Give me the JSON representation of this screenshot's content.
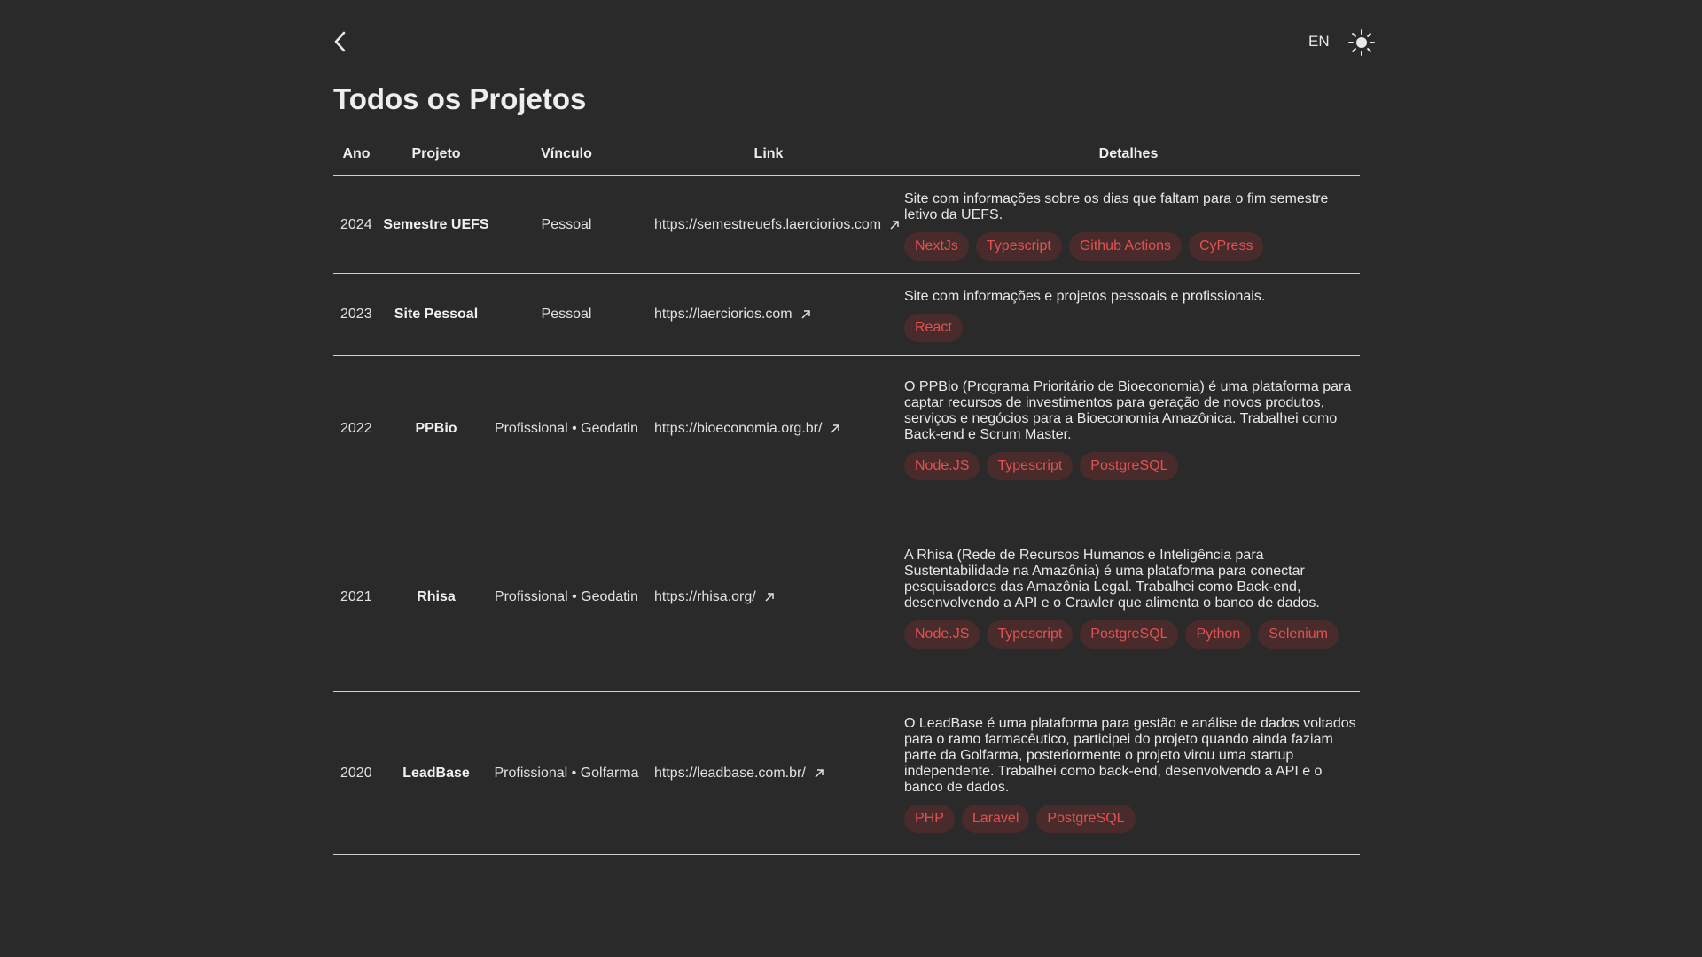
{
  "header": {
    "language": "EN",
    "icons": {
      "back": "chevron-left-icon",
      "theme": "sun-icon"
    }
  },
  "page_title": "Todos os Projetos",
  "table": {
    "headers": [
      "Ano",
      "Projeto",
      "Vínculo",
      "Link",
      "Detalhes"
    ],
    "rows": [
      {
        "year": "2024",
        "project": "Semestre UEFS",
        "link": "https://semestreuefs.laerciorios.com",
        "affiliation": "Pessoal",
        "description": "Site com informações sobre os dias que faltam para o fim semestre letivo da UEFS.",
        "tags": [
          "NextJs",
          "Typescript",
          "Github Actions",
          "CyPress"
        ]
      },
      {
        "year": "2023",
        "project": "Site Pessoal",
        "link": "https://laerciorios.com",
        "affiliation": "Pessoal",
        "description": "Site com informações e projetos pessoais e profissionais.",
        "tags": [
          "React"
        ]
      },
      {
        "year": "2022",
        "project": "PPBio",
        "link": "https://bioeconomia.org.br/",
        "affiliation": "Profissional • Geodatin",
        "description": "O PPBio (Programa Prioritário de Bioeconomia) é uma plataforma para captar recursos de investimentos para geração de novos produtos, serviços e negócios para a Bioeconomia Amazônica. Trabalhei como Back-end e Scrum Master.",
        "tags": [
          "Node.JS",
          "Typescript",
          "PostgreSQL"
        ]
      },
      {
        "year": "2021",
        "project": "Rhisa",
        "link": "https://rhisa.org/",
        "affiliation": "Profissional • Geodatin",
        "description": "A Rhisa (Rede de Recursos Humanos e Inteligência para Sustentabilidade na Amazônia) é uma plataforma para conectar pesquisadores das Amazônia Legal. Trabalhei como Back-end, desenvolvendo a API e o Crawler que alimenta o banco de dados.",
        "tags": [
          "Node.JS",
          "Typescript",
          "PostgreSQL",
          "Python",
          "Selenium"
        ]
      },
      {
        "year": "2020",
        "project": "LeadBase",
        "link": "https://leadbase.com.br/",
        "affiliation": "Profissional • Golfarma",
        "description": "O LeadBase é uma plataforma para gestão e análise de dados voltados para o ramo farmacêutico, participei do projeto quando ainda faziam parte da Golfarma, posteriormente o projeto virou uma startup independente. Trabalhei como back-end, desenvolvendo a API e o banco de dados.",
        "tags": [
          "PHP",
          "Laravel",
          "PostgreSQL"
        ]
      }
    ]
  },
  "colors": {
    "background": "#2a2a2a",
    "text": "#e8e8e8",
    "tag_background": "#4a2b2b",
    "tag_text": "#e05252"
  }
}
